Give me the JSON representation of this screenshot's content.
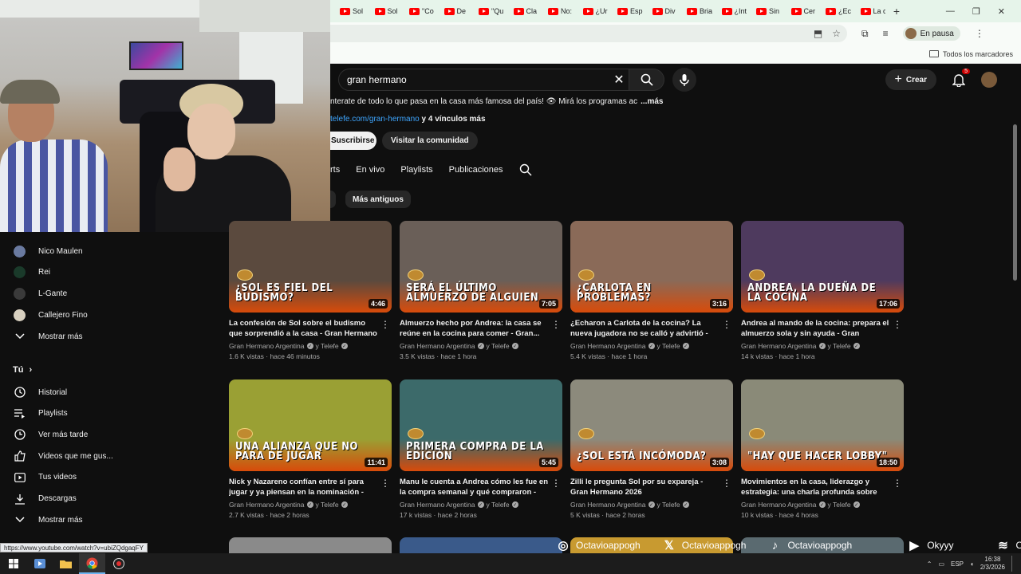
{
  "browser": {
    "tabs": [
      "Sol",
      "Sol",
      "\"Co",
      "De",
      "\"Qu",
      "Cla",
      "No:",
      "¿Ur",
      "Esp",
      "Div",
      "Bria",
      "¿Int",
      "Sin",
      "Cer",
      "¿Ec",
      "La c"
    ],
    "new_tab": "+",
    "profile_status": "En pausa",
    "bookmarks_folder": "Todos los marcadores",
    "status_url": "https://www.youtube.com/watch?v=ubiZQdgaqFY"
  },
  "header": {
    "search_query": "gran hermano",
    "create_label": "Crear",
    "notification_count": "5"
  },
  "channel": {
    "description": "nterate de todo lo que pasa en la casa más famosa del país! 👁 Mirá los programas ac",
    "more": "...más",
    "link": "telefe.com/gran-hermano",
    "links_more": "y 4 vínculos más",
    "subscribe": "Suscribirse",
    "community": "Visitar la comunidad",
    "tabs": [
      "rts",
      "En vivo",
      "Playlists",
      "Publicaciones"
    ],
    "chip": "Más antiguos"
  },
  "sidebar": {
    "subscriptions": [
      {
        "label": "Nico Maulen",
        "color": "#6a7aa0"
      },
      {
        "label": "Rei",
        "color": "#1a3a2a"
      },
      {
        "label": "L-Gante",
        "color": "#3a3a3a"
      },
      {
        "label": "Callejero Fino",
        "color": "#d8d0c0"
      }
    ],
    "show_more_1": "Mostrar más",
    "you_label": "Tú",
    "you_items": [
      {
        "label": "Historial",
        "icon": "history-icon"
      },
      {
        "label": "Playlists",
        "icon": "playlists-icon"
      },
      {
        "label": "Ver más tarde",
        "icon": "watch-later-icon"
      },
      {
        "label": "Videos que me gus...",
        "icon": "liked-icon"
      },
      {
        "label": "Tus videos",
        "icon": "your-videos-icon"
      },
      {
        "label": "Descargas",
        "icon": "downloads-icon"
      }
    ],
    "show_more_2": "Mostrar más"
  },
  "videos": [
    {
      "overlay": "¿SOL ES FIEL DEL BUDISMO?",
      "duration": "4:46",
      "title": "La confesión de Sol sobre el budismo que sorprendió a la casa - Gran Hermano 2026",
      "channel": "Gran Hermano Argentina",
      "collab": "y Telefe",
      "views": "1.6 K vistas",
      "age": "hace 46 minutos",
      "bg": "#5b4a3e"
    },
    {
      "overlay": "SERÁ EL ÚLTIMO ALMUERZO DE ALGUIEN",
      "duration": "7:05",
      "title": "Almuerzo hecho por Andrea: la casa se reúne en la cocina para comer - Gran...",
      "channel": "Gran Hermano Argentina",
      "collab": "y Telefe",
      "views": "3.5 K vistas",
      "age": "hace 1 hora",
      "bg": "#6a5f58"
    },
    {
      "overlay": "¿CARLOTA EN PROBLEMAS?",
      "duration": "3:16",
      "title": "¿Echaron a Carlota de la cocina? La nueva jugadora no se calló y advirtió - Gran...",
      "channel": "Gran Hermano Argentina",
      "collab": "y Telefe",
      "views": "5.4 K vistas",
      "age": "hace 1 hora",
      "bg": "#8a6a58"
    },
    {
      "overlay": "ANDREA, LA DUEÑA DE LA COCINA",
      "duration": "17:06",
      "title": "Andrea al mando de la cocina: prepara el almuerzo sola y sin ayuda - Gran Hermano...",
      "channel": "Gran Hermano Argentina",
      "collab": "y Telefe",
      "views": "14 k vistas",
      "age": "hace 1 hora",
      "bg": "#4e3a5e"
    },
    {
      "overlay": "UNA ALIANZA QUE NO PARA DE JUGAR",
      "duration": "11:41",
      "title": "Nick y Nazareno confían entre sí para jugar y ya piensan en la nominación - Gran Herma...",
      "channel": "Gran Hermano Argentina",
      "collab": "y Telefe",
      "views": "2.7 K vistas",
      "age": "hace 2 horas",
      "bg": "#9aa034"
    },
    {
      "overlay": "PRIMERA COMPRA DE LA EDICIÓN",
      "duration": "5:45",
      "title": "Manu le cuenta a Andrea cómo les fue en la compra semanal y qué compraron - Gran...",
      "channel": "Gran Hermano Argentina",
      "collab": "y Telefe",
      "views": "17 k vistas",
      "age": "hace 2 horas",
      "bg": "#3c6a6a"
    },
    {
      "overlay": "¿SOL ESTÁ INCÓMODA?",
      "duration": "3:08",
      "title": "Zilli le pregunta Sol por su expareja - Gran Hermano 2026",
      "channel": "Gran Hermano Argentina",
      "collab": "y Telefe",
      "views": "5 K vistas",
      "age": "hace 2 horas",
      "bg": "#8c8a7c"
    },
    {
      "overlay": "\"HAY QUE HACER LOBBY\"",
      "duration": "18:50",
      "title": "Movimientos en la casa, liderazgo y estrategia: una charla profunda sobre jueg...",
      "channel": "Gran Hermano Argentina",
      "collab": "y Telefe",
      "views": "10 k vistas",
      "age": "hace 4 horas",
      "bg": "#8a8a78"
    }
  ],
  "social": [
    {
      "icon": "instagram-icon",
      "label": "Octavioappogh"
    },
    {
      "icon": "x-icon",
      "label": "Octavioappogh"
    },
    {
      "icon": "tiktok-icon",
      "label": "Octavioappogh"
    },
    {
      "icon": "youtube-icon",
      "label": "Okyyy"
    },
    {
      "icon": "spotify-icon",
      "label": "Oky"
    }
  ],
  "taskbar": {
    "language": "ESP",
    "time": "16:38",
    "date": "2/3/2026"
  }
}
